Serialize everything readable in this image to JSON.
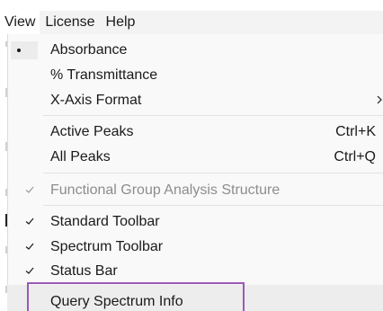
{
  "menubar": {
    "items": [
      {
        "label": "View",
        "active": true
      },
      {
        "label": "License",
        "active": false
      },
      {
        "label": "Help",
        "active": false
      }
    ]
  },
  "view_menu": {
    "radio_group": [
      {
        "label": "Absorbance",
        "selected": true
      },
      {
        "label": "% Transmittance",
        "selected": false
      }
    ],
    "x_axis_format": {
      "label": "X-Axis Format",
      "has_submenu": true,
      "arrow_glyph": "›"
    },
    "peaks": [
      {
        "label": "Active Peaks",
        "shortcut": "Ctrl+K"
      },
      {
        "label": "All Peaks",
        "shortcut": "Ctrl+Q"
      }
    ],
    "functional_group": {
      "label": "Functional Group Analysis Structure",
      "checked": true,
      "disabled": true
    },
    "toolbars": [
      {
        "label": "Standard Toolbar",
        "checked": true
      },
      {
        "label": "Spectrum Toolbar",
        "checked": true
      },
      {
        "label": "Status Bar",
        "checked": true
      }
    ],
    "query": {
      "label": "Query Spectrum Info",
      "highlighted": true
    }
  },
  "colors": {
    "menubar_bg": "#f3f3f3",
    "menu_bg": "#f9f9f9",
    "text": "#1a1a1a",
    "disabled_text": "#8d8d8d",
    "highlight_border": "#9b59b6"
  },
  "icons": {
    "check": "check-icon",
    "bullet": "bullet-icon",
    "submenu": "chevron-right-icon"
  }
}
